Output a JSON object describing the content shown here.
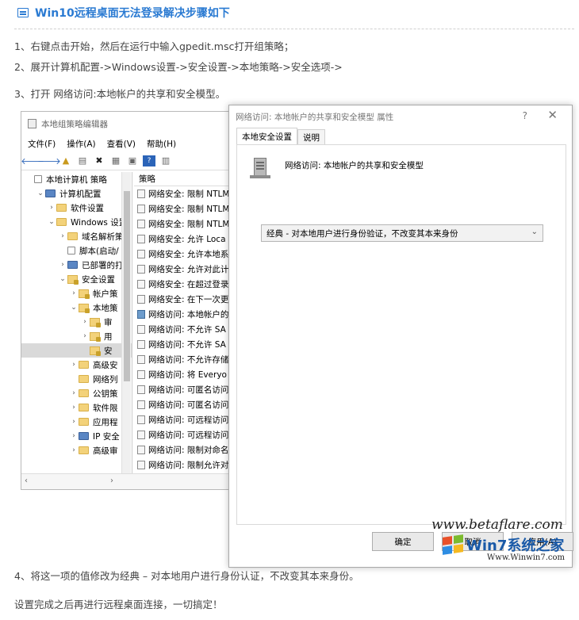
{
  "article": {
    "title": "Win10远程桌面无法登录解决步骤如下",
    "step1": "1、右键点击开始，然后在运行中输入gpedit.msc打开组策略；",
    "step2": "2、展开计算机配置->Windows设置->安全设置->本地策略->安全选项->",
    "step3": "3、打开 网络访问:本地帐户的共享和安全模型。",
    "step4": "4、将这一项的值修改为经典 – 对本地用户进行身份认证，不改变其本来身份。",
    "step5": "设置完成之后再进行远程桌面连接，一切搞定！"
  },
  "gpedit": {
    "window_title": "本地组策略编辑器",
    "menu": [
      "文件(F)",
      "操作(A)",
      "查看(V)",
      "帮助(H)"
    ],
    "tree": [
      {
        "label": "本地计算机 策略",
        "indent": 0,
        "chev": "",
        "icon": "doc"
      },
      {
        "label": "计算机配置",
        "indent": 1,
        "chev": "⌄",
        "icon": "pc"
      },
      {
        "label": "软件设置",
        "indent": 2,
        "chev": "›",
        "icon": "folder"
      },
      {
        "label": "Windows 设置",
        "indent": 2,
        "chev": "⌄",
        "icon": "folder"
      },
      {
        "label": "域名解析策",
        "indent": 3,
        "chev": "›",
        "icon": "folder"
      },
      {
        "label": "脚本(启动/",
        "indent": 3,
        "chev": "",
        "icon": "doc"
      },
      {
        "label": "已部署的打",
        "indent": 3,
        "chev": "›",
        "icon": "pc"
      },
      {
        "label": "安全设置",
        "indent": 3,
        "chev": "⌄",
        "icon": "lock"
      },
      {
        "label": "帐户策",
        "indent": 4,
        "chev": "›",
        "icon": "lock"
      },
      {
        "label": "本地策",
        "indent": 4,
        "chev": "⌄",
        "icon": "lock"
      },
      {
        "label": "审",
        "indent": 5,
        "chev": "›",
        "icon": "lock"
      },
      {
        "label": "用",
        "indent": 5,
        "chev": "›",
        "icon": "lock"
      },
      {
        "label": "安",
        "indent": 5,
        "chev": "",
        "icon": "lock"
      },
      {
        "label": "高级安",
        "indent": 4,
        "chev": "›",
        "icon": "folder"
      },
      {
        "label": "网络列",
        "indent": 4,
        "chev": "",
        "icon": "folder"
      },
      {
        "label": "公钥策",
        "indent": 4,
        "chev": "›",
        "icon": "folder"
      },
      {
        "label": "软件限",
        "indent": 4,
        "chev": "›",
        "icon": "folder"
      },
      {
        "label": "应用程",
        "indent": 4,
        "chev": "›",
        "icon": "folder"
      },
      {
        "label": "IP 安全",
        "indent": 4,
        "chev": "›",
        "icon": "pc"
      },
      {
        "label": "高级审",
        "indent": 4,
        "chev": "›",
        "icon": "folder"
      }
    ],
    "policy_header": "策略",
    "policies": [
      "网络安全: 限制 NTLM",
      "网络安全: 限制 NTLM",
      "网络安全: 限制 NTLM",
      "网络安全: 允许 Loca",
      "网络安全: 允许本地系",
      "网络安全: 允许对此计",
      "网络安全: 在超过登录",
      "网络安全: 在下一次更",
      "网络访问: 本地帐户的",
      "网络访问: 不允许 SA",
      "网络访问: 不允许 SA",
      "网络访问: 不允许存储",
      "网络访问: 将 Everyo",
      "网络访问: 可匿名访问",
      "网络访问: 可匿名访问",
      "网络访问: 可远程访问",
      "网络访问: 可远程访问",
      "网络访问: 限制对命名",
      "网络访问: 限制允许对"
    ]
  },
  "dialog": {
    "title": "网络访问: 本地帐户的共享和安全模型 属性",
    "help": "?",
    "close": "✕",
    "tab_local": "本地安全设置",
    "tab_explain": "说明",
    "policy_name": "网络访问: 本地帐户的共享和安全模型",
    "select_value": "经典 - 对本地用户进行身份验证，不改变其本来身份",
    "ok": "确定",
    "cancel": "取消",
    "apply": "应用(A)"
  },
  "watermark": {
    "betaflare": "www.betaflare.com",
    "brand": "Win7系统之家",
    "url": "Www.Winwin7.com"
  }
}
